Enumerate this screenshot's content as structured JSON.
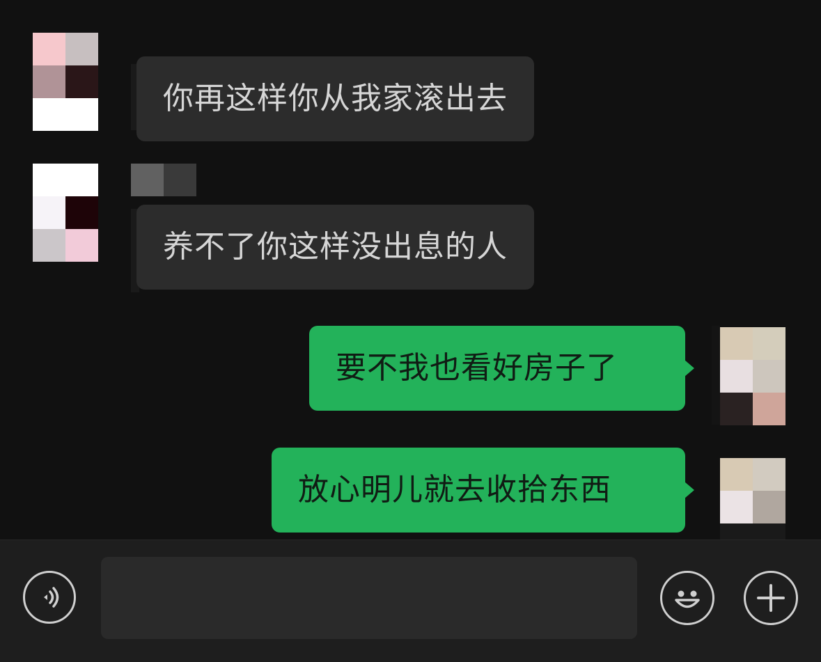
{
  "conversation": {
    "messages": [
      {
        "direction": "incoming",
        "text": "你再这样你从我家滚出去"
      },
      {
        "direction": "incoming",
        "text": "养不了你这样没出息的人"
      },
      {
        "direction": "outgoing",
        "text": "要不我也看好房子了"
      },
      {
        "direction": "outgoing",
        "text": "放心明儿就去收拾东西"
      }
    ]
  },
  "input_bar": {
    "voice_icon": "voice-icon",
    "text_value": "",
    "emoji_icon": "emoji-icon",
    "more_icon": "plus-icon"
  },
  "colors": {
    "background": "#111111",
    "incoming_bubble": "#2c2c2c",
    "outgoing_bubble": "#23b25a",
    "input_bar": "#1e1e1e"
  }
}
